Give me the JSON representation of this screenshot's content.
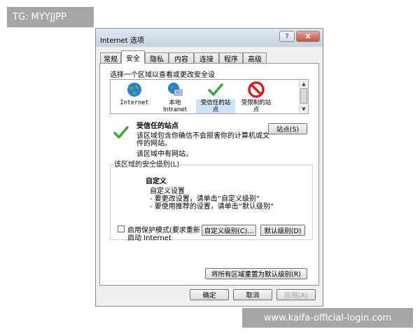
{
  "overlay": {
    "tg": "TG: MYYJJPP",
    "site": "www.kaifa-official-login.com"
  },
  "dialog": {
    "title": "Internet 选项",
    "help": "?",
    "close": "X",
    "tabs": [
      "常规",
      "安全",
      "隐私",
      "内容",
      "连接",
      "程序",
      "高级"
    ],
    "active_tab": "安全",
    "prompt": "选择一个区域以查看或更改安全设",
    "zones": [
      {
        "name": "Internet",
        "icon": "globe-icon"
      },
      {
        "name": "本地\nIntranet",
        "icon": "intranet-icon"
      },
      {
        "name": "受信任的站\n点",
        "icon": "checkmark-icon"
      },
      {
        "name": "受限制的站\n点",
        "icon": "no-entry-icon"
      }
    ],
    "zone_title": "受信任的站点",
    "zone_desc1": "该区域包含你确信不会损害你的计算机或文",
    "zone_desc2": "件的网站。",
    "zone_desc3": "该区域中有网站。",
    "sites_button": "站点(S)",
    "security_level_label": "该区域的安全级别(L)",
    "custom_title": "自定义",
    "custom_line1": "自定义设置",
    "custom_line2": "- 要更改设置，请单击“自定义级别”",
    "custom_line3": "- 要使用推荐的设置，请单击“默认级别”",
    "protected_mode_line1": "启用保护模式(要求重新",
    "protected_mode_line2": "启动 Internet",
    "custom_level_button": "自定义级别(C)...",
    "default_level_button": "默认级别(D)",
    "reset_all_button": "将所有区域重置为默认级别(R)",
    "ok_button": "确定",
    "cancel_button": "取消",
    "apply_button": "应用(A)"
  },
  "colors": {
    "selection": "#cfe3f7",
    "check_green": "#3aa53a",
    "no_entry_red": "#d21f1f"
  }
}
